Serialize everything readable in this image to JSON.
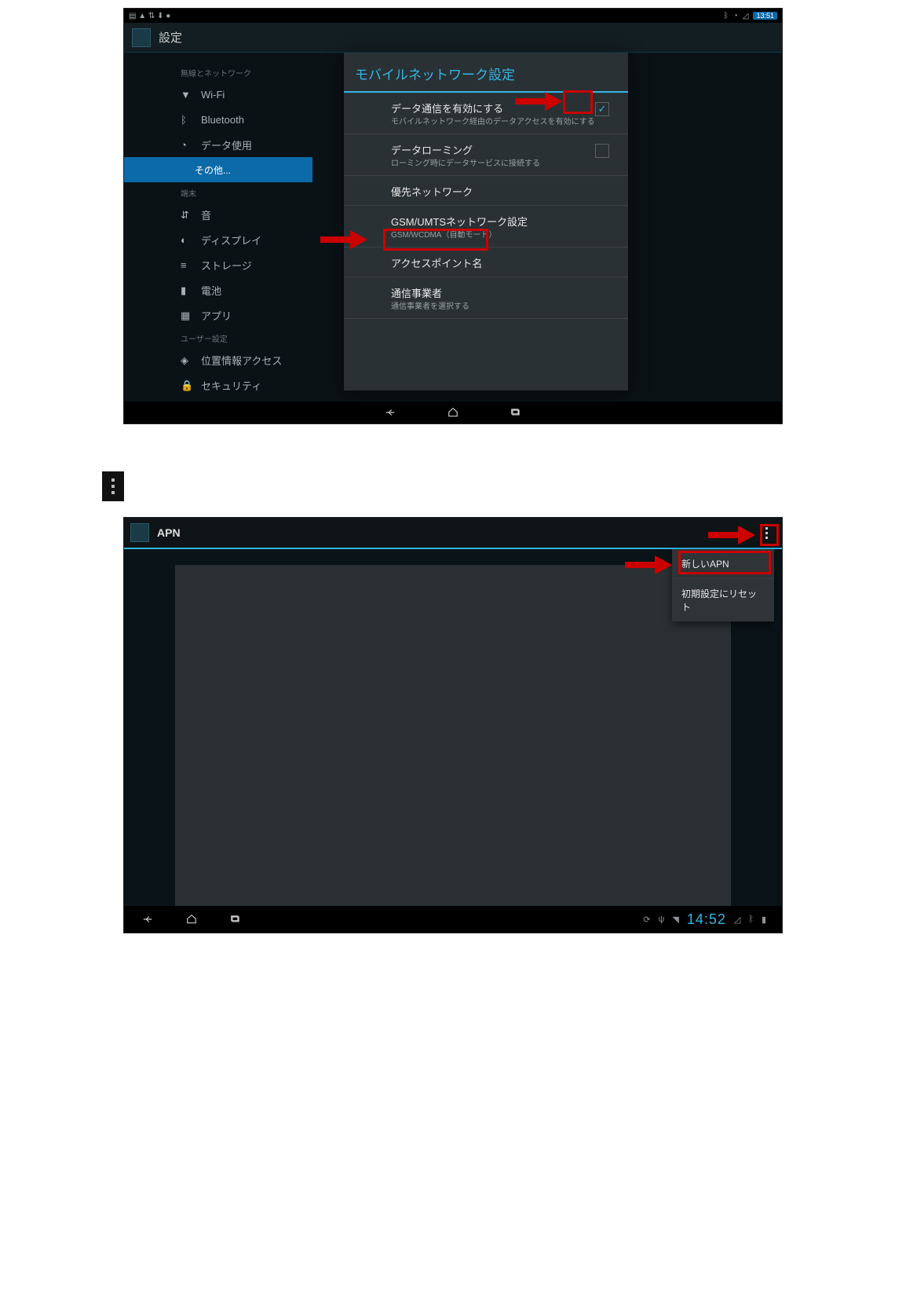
{
  "screenshot1": {
    "statusbar": {
      "time": "13:51"
    },
    "appbar_title": "設定",
    "sidebar": {
      "section1": "無線とネットワーク",
      "items1": [
        {
          "icon": "wifi",
          "label": "Wi-Fi"
        },
        {
          "icon": "bluetooth",
          "label": "Bluetooth"
        },
        {
          "icon": "data",
          "label": "データ使用"
        },
        {
          "icon": "",
          "label": "その他...",
          "active": true
        }
      ],
      "section2": "端末",
      "items2": [
        {
          "icon": "sound",
          "label": "音"
        },
        {
          "icon": "display",
          "label": "ディスプレイ"
        },
        {
          "icon": "storage",
          "label": "ストレージ"
        },
        {
          "icon": "battery",
          "label": "電池"
        },
        {
          "icon": "apps",
          "label": "アプリ"
        }
      ],
      "section3": "ユーザー設定",
      "items3": [
        {
          "icon": "location",
          "label": "位置情報アクセス"
        },
        {
          "icon": "security",
          "label": "セキュリティ"
        }
      ]
    },
    "dialog": {
      "title": "モバイルネットワーク設定",
      "items": [
        {
          "title": "データ通信を有効にする",
          "sub": "モバイルネットワーク経由のデータアクセスを有効にする",
          "checked": true
        },
        {
          "title": "データローミング",
          "sub": "ローミング時にデータサービスに接続する",
          "checked": false
        },
        {
          "title": "優先ネットワーク",
          "sub": ""
        },
        {
          "title": "GSM/UMTSネットワーク設定",
          "sub": "GSM/WCDMA（自動モード）"
        },
        {
          "title": "アクセスポイント名",
          "sub": ""
        },
        {
          "title": "通信事業者",
          "sub": "通信事業者を選択する"
        }
      ]
    }
  },
  "screenshot2": {
    "appbar_title": "APN",
    "dropdown": {
      "item1": "新しいAPN",
      "item2": "初期設定にリセット"
    },
    "statusbar": {
      "time": "14:52"
    }
  }
}
